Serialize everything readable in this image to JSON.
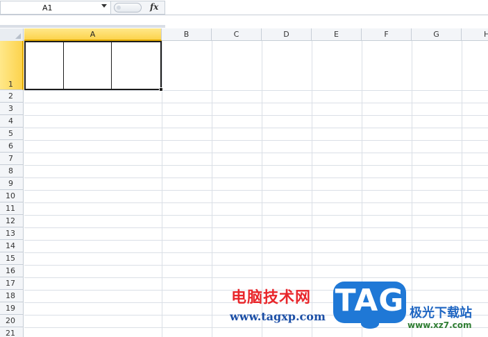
{
  "formula_bar": {
    "name_box_value": "A1",
    "fx_label": "fx",
    "formula_value": ""
  },
  "columns": [
    "A",
    "B",
    "C",
    "D",
    "E",
    "F",
    "G",
    "H"
  ],
  "active_column": "A",
  "rows": [
    "1",
    "2",
    "3",
    "4",
    "5",
    "6",
    "7",
    "8",
    "9",
    "10",
    "11",
    "12",
    "13",
    "14",
    "15",
    "16",
    "17",
    "18",
    "19",
    "20",
    "21"
  ],
  "active_row": "1",
  "selected_cell": "A1",
  "colors": {
    "header_active": "#fcd34d",
    "gridline": "#dadfe6",
    "header_bg": "#f3f5f8"
  },
  "watermark": {
    "chinese_title": "电脑技术网",
    "url": "www.tagxp.com",
    "logo_text": "TAG",
    "site_name": "极光下载站",
    "site_url": "www.xz7.com"
  }
}
